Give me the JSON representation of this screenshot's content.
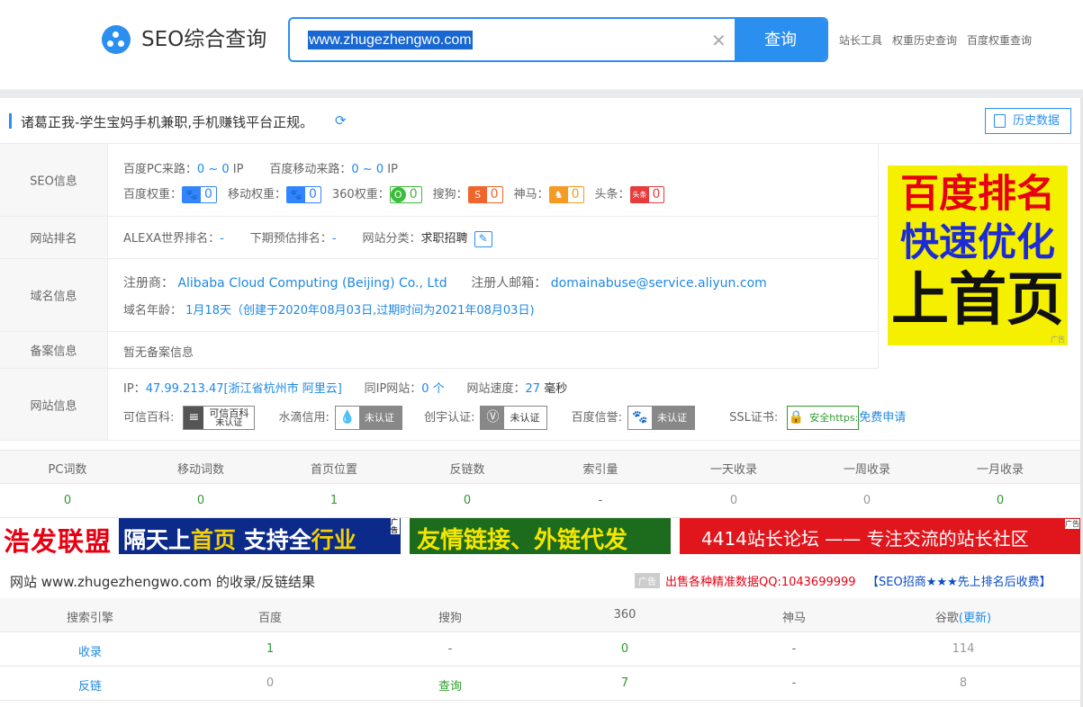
{
  "header": {
    "title": "SEO综合查询",
    "search_value": "www.zhugezhengwo.com",
    "search_button": "查询",
    "links": [
      "站长工具",
      "权重历史查询",
      "百度权重查询"
    ]
  },
  "site": {
    "title": "诸葛正我-学生宝妈手机兼职,手机赚钱平台正规。",
    "history_button": "历史数据"
  },
  "seo_info": {
    "label": "SEO信息",
    "pc_traffic_label": "百度PC来路：",
    "pc_traffic_value": "0 ~ 0",
    "pc_traffic_unit": "IP",
    "mobile_traffic_label": "百度移动来路：",
    "mobile_traffic_value": "0 ~ 0",
    "mobile_traffic_unit": "IP",
    "weights": [
      {
        "label": "百度权重：",
        "value": "0",
        "icon": "baidu-icon"
      },
      {
        "label": "移动权重：",
        "value": "0",
        "icon": "baidu-icon"
      },
      {
        "label": "360权重：",
        "value": "0",
        "icon": "360-icon"
      },
      {
        "label": "搜狗：",
        "value": "0",
        "icon": "sogou-icon"
      },
      {
        "label": "神马：",
        "value": "0",
        "icon": "shenma-icon"
      },
      {
        "label": "头条：",
        "value": "0",
        "icon": "toutiao-icon",
        "icon_text": "头条"
      }
    ]
  },
  "rank": {
    "label": "网站排名",
    "alexa_label": "ALEXA世界排名：",
    "alexa_value": "-",
    "forecast_label": "下期预估排名：",
    "forecast_value": "-",
    "category_label": "网站分类：",
    "category_value": "求职招聘"
  },
  "domain": {
    "label": "域名信息",
    "registrar_label": "注册商：",
    "registrar_value": "Alibaba Cloud Computing (Beijing) Co., Ltd",
    "email_label": "注册人邮箱：",
    "email_value": "domainabuse@service.aliyun.com",
    "age_label": "域名年龄：",
    "age_value": "1月18天（创建于2020年08月03日,过期时间为2021年08月03日)"
  },
  "beian": {
    "label": "备案信息",
    "value": "暂无备案信息"
  },
  "web": {
    "label": "网站信息",
    "ip_label": "IP：",
    "ip_value": "47.99.213.47[浙江省杭州市 阿里云]",
    "same_ip_label": "同IP网站：",
    "same_ip_value": "0 个",
    "speed_label": "网站速度：",
    "speed_value": "27",
    "speed_unit": "毫秒",
    "kexin_label": "可信百科:",
    "kexin_badge": "可信百科",
    "kexin_status": "未认证",
    "shuidi_label": "水滴信用:",
    "shuidi_status": "未认证",
    "chuangyu_label": "创宇认证:",
    "chuangyu_status": "未认证",
    "baidu_label": "百度信誉:",
    "baidu_status": "未认证",
    "ssl_label": "SSL证书:",
    "ssl_badge": "安全https:",
    "ssl_link": "免费申请"
  },
  "ad_square": {
    "line1": "百度排名",
    "line2": "快速优化",
    "line3": "上首页",
    "tag": "广告"
  },
  "stats": {
    "headers": [
      "PC词数",
      "移动词数",
      "首页位置",
      "反链数",
      "索引量",
      "一天收录",
      "一周收录",
      "一月收录"
    ],
    "values": [
      "0",
      "0",
      "1",
      "0",
      "-",
      "0",
      "0",
      "0"
    ]
  },
  "banners": {
    "b1_left": "浩发联盟",
    "b1_right_a": "隔天上",
    "b1_right_b": "首页",
    "b1_right_c": " 支持全",
    "b1_right_d": "行业",
    "b2": "友情链接、外链代发",
    "b3": "4414站长论坛 —— 专注交流的站长社区",
    "tag": "广告"
  },
  "results": {
    "title": "网站 www.zhugezhengwo.com 的收录/反链结果",
    "ad_tag": "广告",
    "ad_text": "出售各种精准数据QQ:1043699999",
    "promo": "【SEO招商★★★先上排名后收费】",
    "headers": [
      "搜索引擎",
      "百度",
      "搜狗",
      "360",
      "神马",
      "谷歌"
    ],
    "google_update": "(更新)",
    "rows": [
      {
        "name": "收录",
        "values": [
          "1",
          "-",
          "0",
          "-",
          "114"
        ]
      },
      {
        "name": "反链",
        "values": [
          "0",
          "查询",
          "7",
          "-",
          "8"
        ]
      }
    ]
  }
}
